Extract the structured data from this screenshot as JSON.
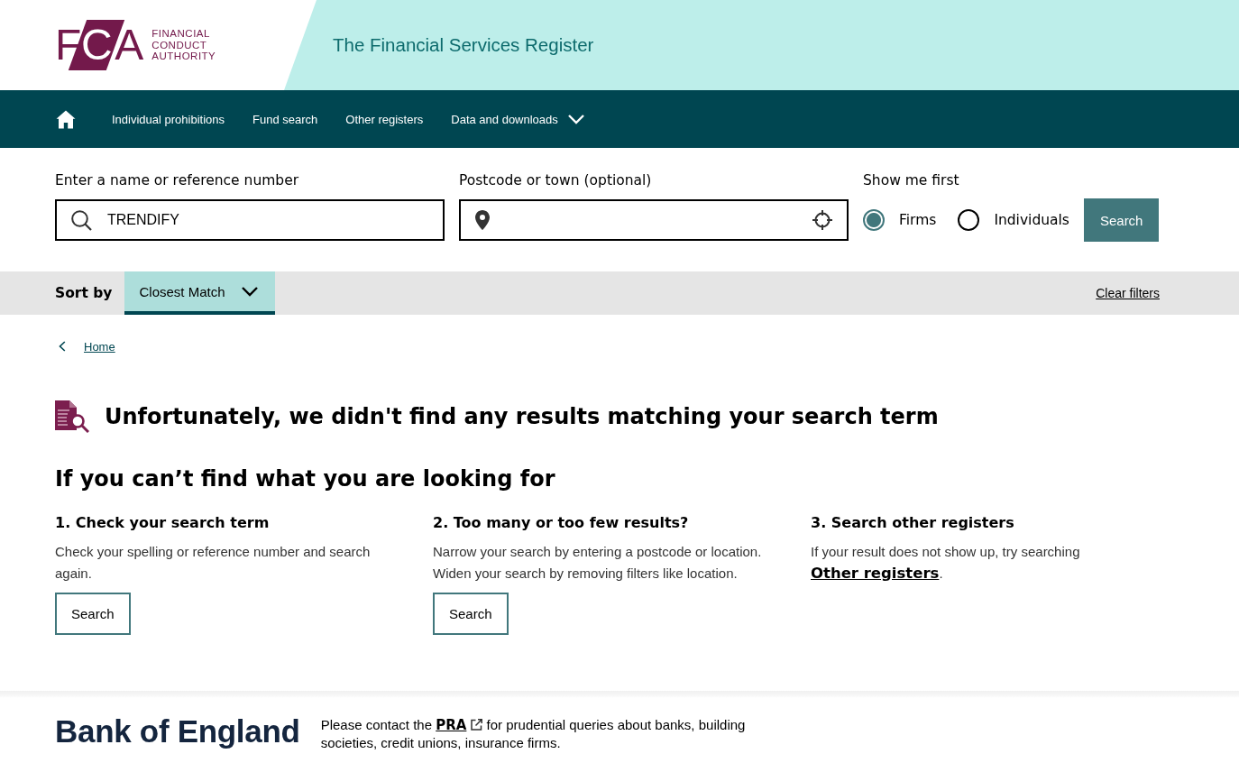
{
  "header": {
    "logo": {
      "letters": "FCA",
      "lines": [
        "FINANCIAL",
        "CONDUCT",
        "AUTHORITY"
      ]
    },
    "title": "The Financial Services Register"
  },
  "nav": {
    "items": [
      {
        "label": "Individual prohibitions",
        "kind": "link"
      },
      {
        "label": "Fund search",
        "kind": "link"
      },
      {
        "label": "Other registers",
        "kind": "link"
      },
      {
        "label": "Data and downloads",
        "kind": "dropdown"
      }
    ]
  },
  "search": {
    "name_field": {
      "label": "Enter a name or reference number",
      "value": "TRENDIFY"
    },
    "location_field": {
      "label": "Postcode or town (optional)"
    },
    "show_first": {
      "label": "Show me first",
      "options": [
        {
          "label": "Firms",
          "selected": true
        },
        {
          "label": "Individuals",
          "selected": false
        }
      ]
    },
    "button": "Search"
  },
  "sort_bar": {
    "label": "Sort by",
    "value": "Closest Match",
    "clear_link": "Clear filters"
  },
  "breadcrumb": {
    "link": "Home"
  },
  "no_results": {
    "message": "Unfortunately, we didn't find any results matching your search term"
  },
  "help": {
    "title": "If you can’t find what you are looking for",
    "steps": [
      {
        "kind": "button",
        "heading": "1. Check your search term",
        "text": "Check your spelling or reference number and search again.",
        "button": "Search"
      },
      {
        "kind": "button",
        "heading": "2. Too many or too few results?",
        "text": "Narrow your search by entering a postcode or location. Widen your search by removing filters like location.",
        "button": "Search"
      },
      {
        "kind": "link",
        "heading": "3. Search other registers",
        "text": "If your result does not show up, try searching",
        "link": "Other registers",
        "text_after": "."
      }
    ]
  },
  "footer": {
    "logo": "Bank of England",
    "text_before": "Please contact the",
    "link": "PRA",
    "text_after": "for prudential queries about banks, building societies, credit unions, insurance firms."
  }
}
